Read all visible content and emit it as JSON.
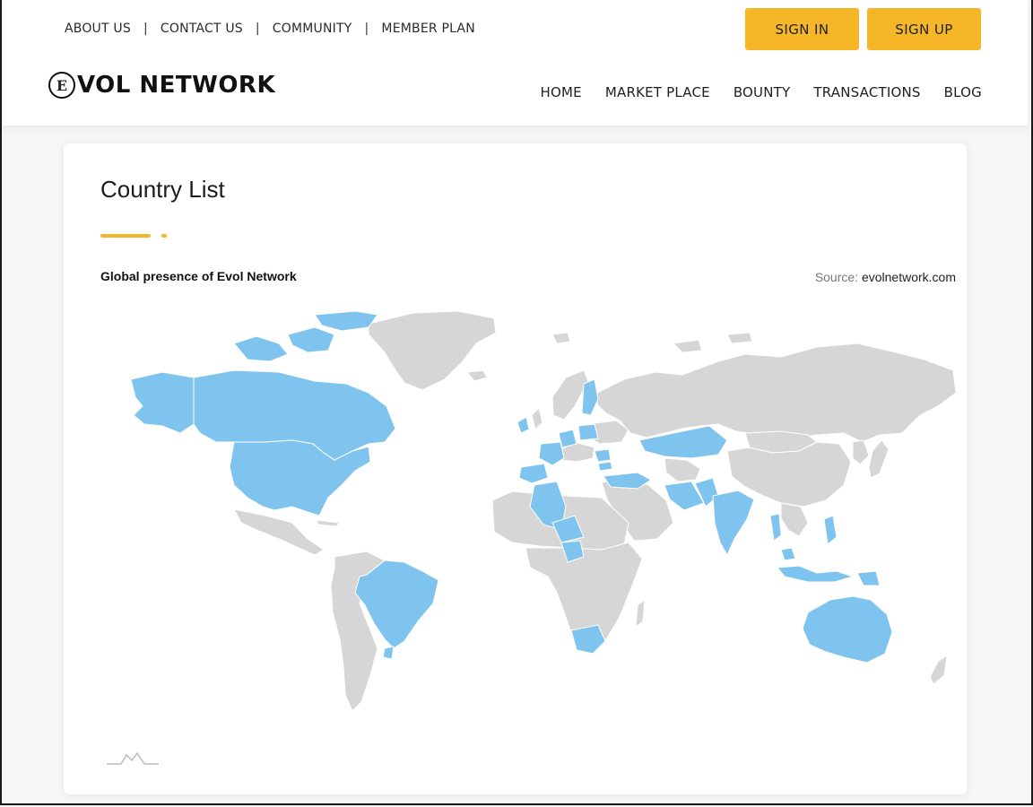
{
  "header": {
    "top_links": [
      "ABOUT US",
      "CONTACT US",
      "COMMUNITY",
      "MEMBER PLAN"
    ],
    "separator": "|",
    "auth": {
      "sign_in": "SIGN IN",
      "sign_up": "SIGN UP"
    },
    "logo": {
      "mark": "E",
      "text": "VOL NETWORK"
    },
    "nav": [
      "HOME",
      "MARKET PLACE",
      "BOUNTY",
      "TRANSACTIONS",
      "BLOG"
    ]
  },
  "card": {
    "title": "Country List",
    "map_title": "Global presence of Evol Network",
    "source_label": "Source:",
    "source_link": "evolnetwork.com"
  },
  "map": {
    "colors": {
      "highlight": "#7ec4ee",
      "other": "#d6d6d6",
      "border": "#ffffff",
      "accent": "#f5b728"
    },
    "highlighted_regions": [
      "Alaska",
      "Canada",
      "Canadian Arctic Islands",
      "United States",
      "Brazil",
      "Uruguay",
      "Ireland",
      "France",
      "Spain",
      "Germany",
      "Poland",
      "Finland",
      "Romania",
      "Bulgaria",
      "Turkey",
      "Algeria",
      "Niger",
      "Nigeria",
      "Kazakhstan",
      "Iran",
      "Pakistan",
      "India",
      "Thailand",
      "Malaysia",
      "Indonesia",
      "Philippines",
      "Papua New Guinea",
      "South Africa",
      "Australia"
    ]
  }
}
